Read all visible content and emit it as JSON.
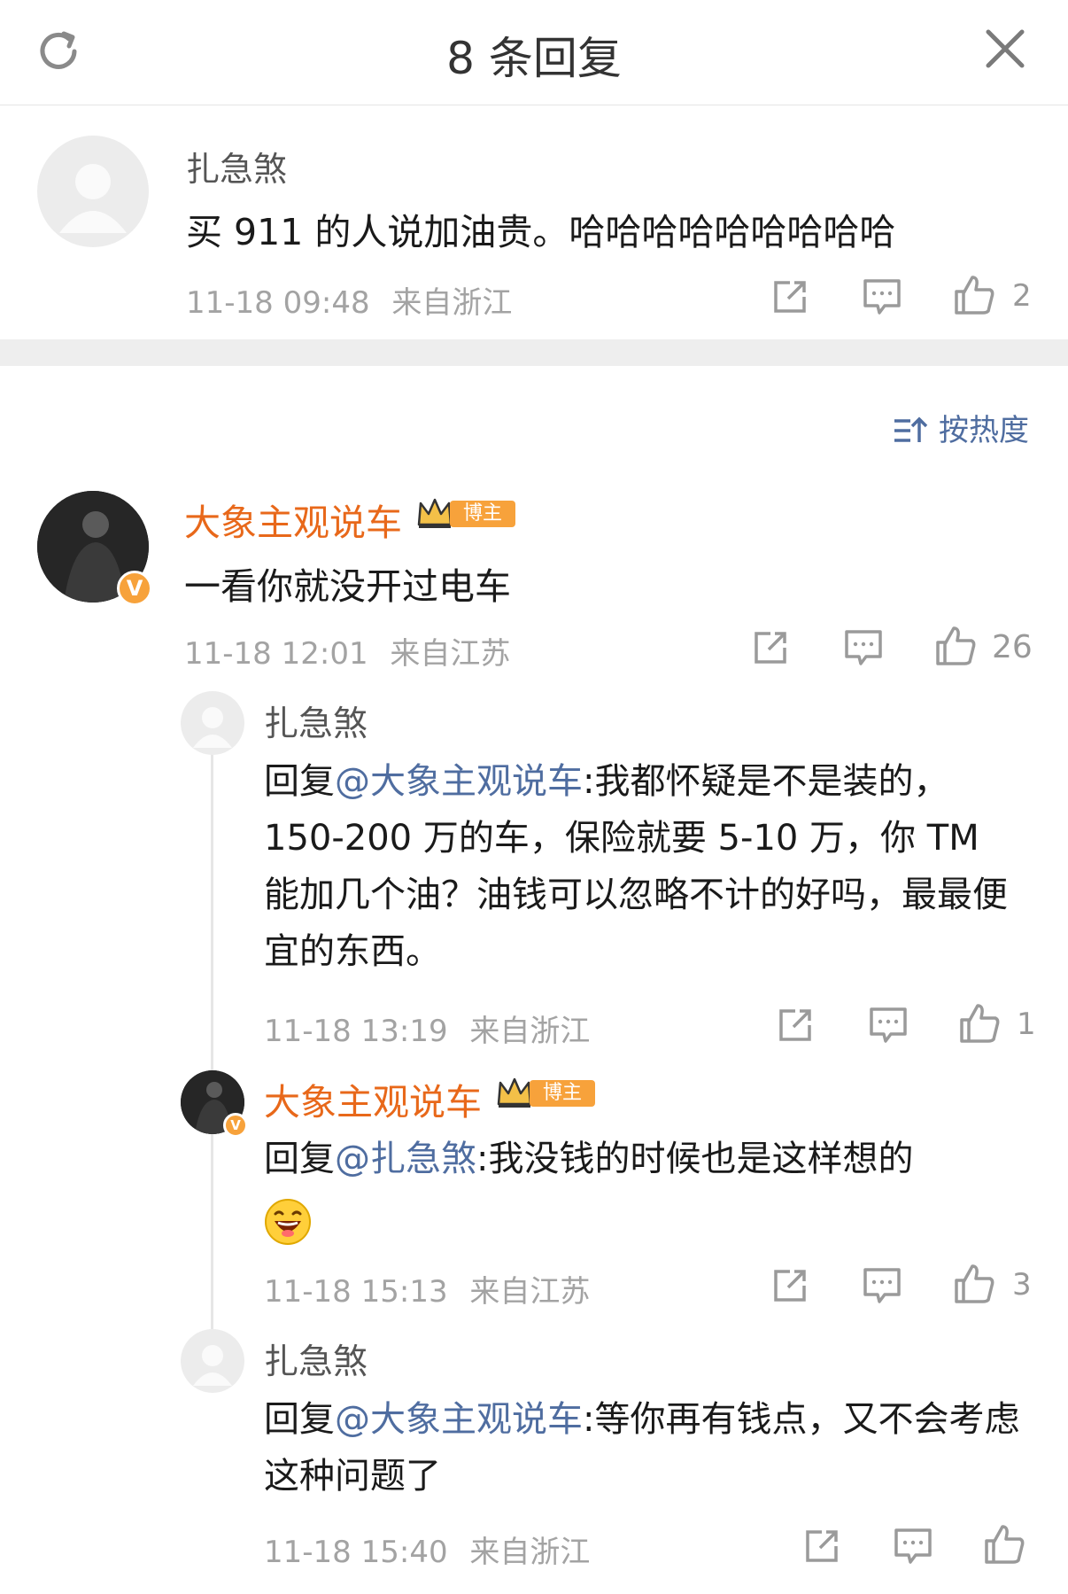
{
  "header": {
    "title": "8 条回复"
  },
  "main_comment": {
    "username": "扎急煞",
    "text": "买 911 的人说加油贵。哈哈哈哈哈哈哈哈哈",
    "time": "11-18 09:48",
    "location": "来自浙江",
    "likes": "2"
  },
  "sort": {
    "label": "按热度"
  },
  "replies": [
    {
      "username": "大象主观说车",
      "badge": "博主",
      "text": "一看你就没开过电车",
      "time": "11-18 12:01",
      "location": "来自江苏",
      "likes": "26"
    },
    {
      "username": "扎急煞",
      "reply_prefix": "回复",
      "mention": "@大象主观说车",
      "text": ":我都怀疑是不是装的，150-200 万的车，保险就要 5-10 万，你 TM 能加几个油？油钱可以忽略不计的好吗，最最便宜的东西。",
      "time": "11-18 13:19",
      "location": "来自浙江",
      "likes": "1"
    },
    {
      "username": "大象主观说车",
      "badge": "博主",
      "reply_prefix": "回复",
      "mention": "@扎急煞",
      "text": ":我没钱的时候也是这样想的",
      "emoji": "laughing-face",
      "time": "11-18 15:13",
      "location": "来自江苏",
      "likes": "3"
    },
    {
      "username": "扎急煞",
      "reply_prefix": "回复",
      "mention": "@大象主观说车",
      "text": ":等你再有钱点，又不会考虑这种问题了",
      "time": "11-18 15:40",
      "location": "来自浙江",
      "likes": ""
    }
  ],
  "colors": {
    "accent_name": "#e8681a",
    "link": "#4f6da0",
    "meta": "#a3a3a3",
    "badge": "#f7a23b"
  },
  "icons": [
    "refresh-icon",
    "close-icon",
    "share-icon",
    "comment-icon",
    "like-icon",
    "sort-icon",
    "crown-icon",
    "verified-icon"
  ]
}
